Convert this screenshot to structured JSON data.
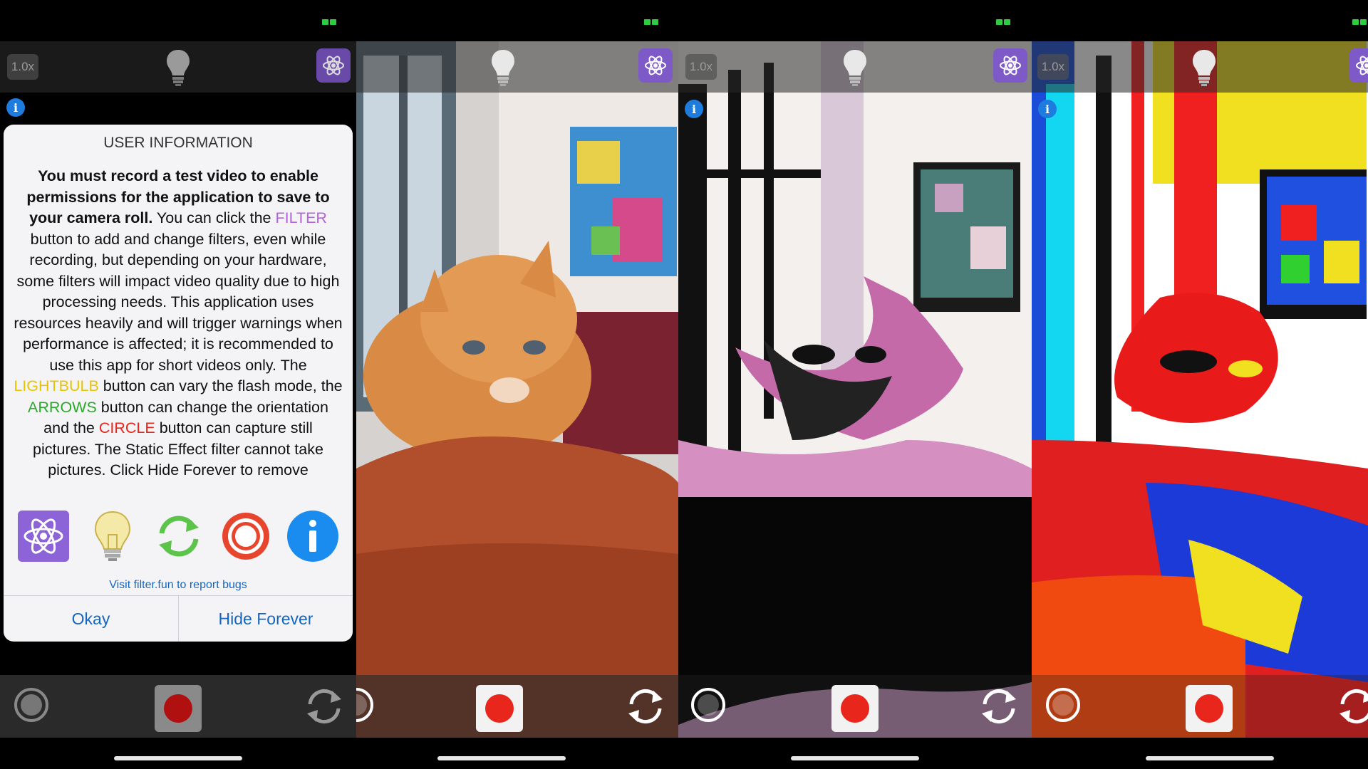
{
  "panels": [
    {
      "zoom": "1.0x"
    },
    {
      "zoom": ""
    },
    {
      "zoom": "1.0x"
    },
    {
      "zoom": "1.0x"
    }
  ],
  "info_icon_label": "i",
  "dialog": {
    "title": "USER INFORMATION",
    "bold_text": "You must record a test video to enable permissions for the application to save to your camera roll.",
    "text_1": " You can click the ",
    "filter_word": "FILTER",
    "text_2": " button to add and change filters, even while recording, but depending on your hardware, some filters will impact video quality due to high processing needs. This application uses resources heavily and will trigger warnings when performance is affected; it is recommended to use this app for short videos only. The ",
    "lightbulb_word": "LIGHTBULB",
    "text_3": " button can vary the flash mode, the ",
    "arrows_word": "ARROWS",
    "text_4": " button can change the orientation and the ",
    "circle_word": "CIRCLE",
    "text_5": " button can capture still pictures. The Static Effect filter cannot take pictures. Click Hide Forever to remove",
    "icons": [
      "atom-icon",
      "lightbulb-icon",
      "rotate-arrows-icon",
      "capture-circle-icon",
      "info-icon"
    ],
    "link_text": "Visit filter.fun to report bugs",
    "okay_label": "Okay",
    "hide_forever_label": "Hide Forever"
  },
  "colors": {
    "accent_purple": "#7d5ac8",
    "filter_text": "#b264d8",
    "lightbulb_text": "#e8c400",
    "arrows_text": "#2aaa2a",
    "circle_text": "#e8261c",
    "link_blue": "#1566c0",
    "record_red": "#e8261c"
  }
}
